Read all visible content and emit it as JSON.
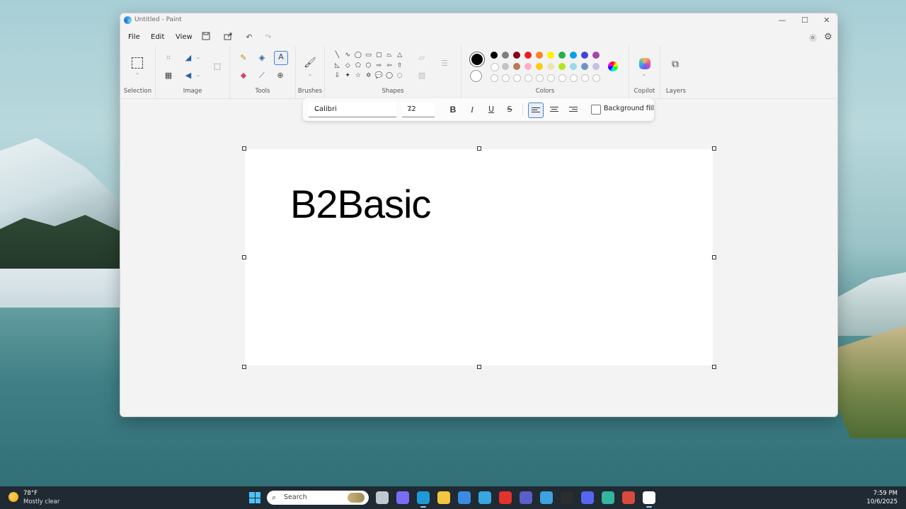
{
  "window": {
    "title": "Untitled - Paint",
    "controls": {
      "minimize": "—",
      "maximize": "☐",
      "close": "✕"
    }
  },
  "menubar": {
    "items": [
      "File",
      "Edit",
      "View"
    ],
    "account_badge": "a"
  },
  "ribbon": {
    "groups": {
      "selection": "Selection",
      "image": "Image",
      "tools": "Tools",
      "brushes": "Brushes",
      "shapes": "Shapes",
      "colors": "Colors",
      "copilot": "Copilot",
      "layers": "Layers"
    },
    "shapes": [
      "╲",
      "∿",
      "◯",
      "▭",
      "▢",
      "⏢",
      "△",
      "◺",
      "◇",
      "⬠",
      "⬡",
      "⇨",
      "⇦",
      "⇧",
      "⇩",
      "✦",
      "☆",
      "✡",
      "💬",
      "◯",
      "◌"
    ],
    "colors_row1": [
      "#000000",
      "#7f7f7f",
      "#880015",
      "#ed1c24",
      "#ff7f27",
      "#fff200",
      "#22b14c",
      "#00a2e8",
      "#3f48cc",
      "#a349a4"
    ],
    "colors_row2": [
      "#ffffff",
      "#c3c3c3",
      "#b97a57",
      "#ffaec9",
      "#ffc90e",
      "#efe4b0",
      "#b5e61d",
      "#99d9ea",
      "#7092be",
      "#c8bfe7"
    ],
    "primary_color": "#000000",
    "secondary_color": "#ffffff"
  },
  "textbar": {
    "font": "Calibri",
    "size": "72",
    "bold": "B",
    "italic": "I",
    "underline": "U",
    "strike": "S",
    "background_fill": "Background fill",
    "alignment": "left"
  },
  "canvas": {
    "text": "B2Basic"
  },
  "taskbar": {
    "weather_temp": "78°F",
    "weather_desc": "Mostly clear",
    "search_placeholder": "Search",
    "time": "7:59 PM",
    "date": "10/6/2025",
    "apps": [
      {
        "name": "task-view",
        "color": "#bfc7cf"
      },
      {
        "name": "copilot",
        "color": "#7b6cf6"
      },
      {
        "name": "edge",
        "color": "#1e9bd7",
        "active": true
      },
      {
        "name": "file-explorer",
        "color": "#f3c640"
      },
      {
        "name": "store",
        "color": "#3b8be3"
      },
      {
        "name": "browser",
        "color": "#39a7e0"
      },
      {
        "name": "app-red",
        "color": "#e5322b"
      },
      {
        "name": "teams",
        "color": "#5b5fc7"
      },
      {
        "name": "photos",
        "color": "#3fa1e0"
      },
      {
        "name": "app-rl",
        "color": "#2d2d2d"
      },
      {
        "name": "discord",
        "color": "#5865f2"
      },
      {
        "name": "app-globe",
        "color": "#33b5a0"
      },
      {
        "name": "app-chrome",
        "color": "#d84a3f"
      },
      {
        "name": "app-paint",
        "color": "#ffffff",
        "active": true
      }
    ]
  }
}
